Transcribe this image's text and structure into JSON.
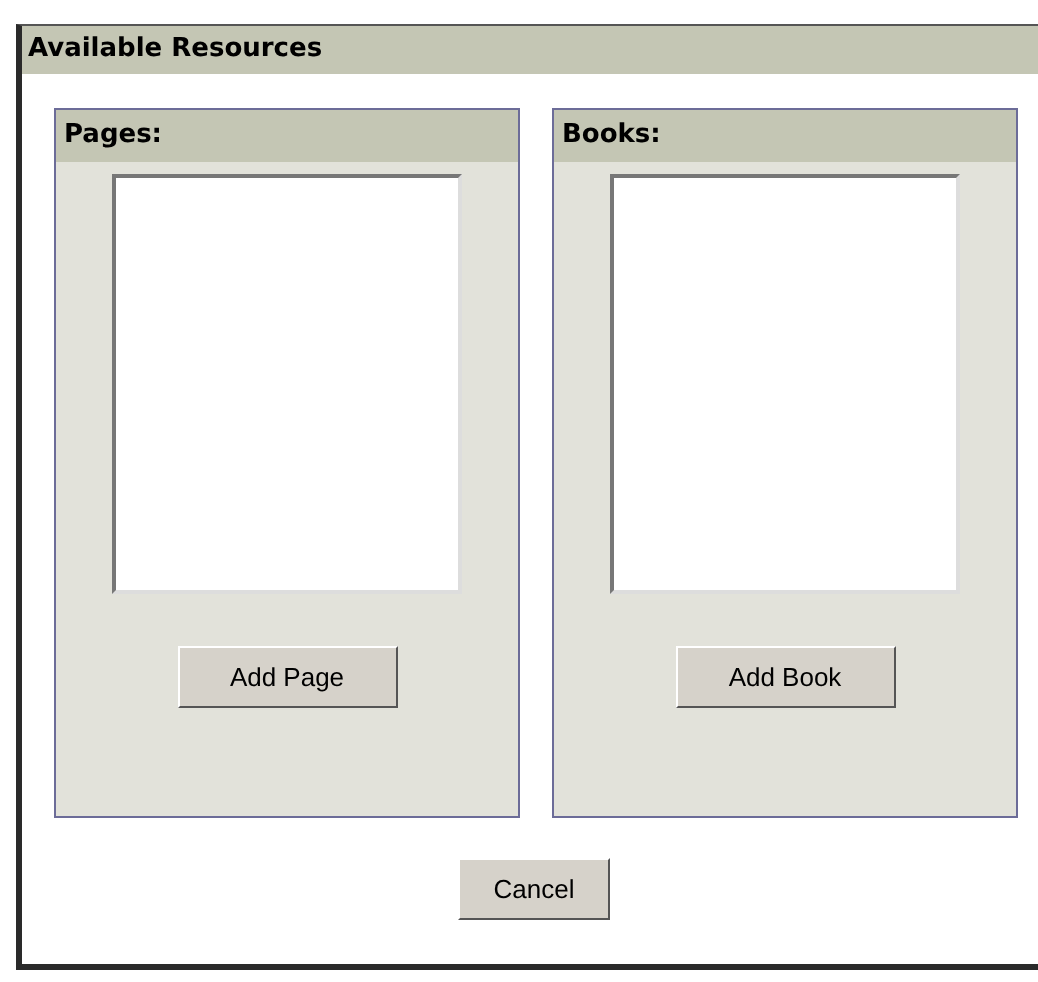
{
  "dialog": {
    "title": "Available Resources",
    "panels": [
      {
        "title": "Pages:",
        "button": "Add Page"
      },
      {
        "title": "Books:",
        "button": "Add Book"
      }
    ],
    "buttons": [
      "Cancel"
    ]
  }
}
